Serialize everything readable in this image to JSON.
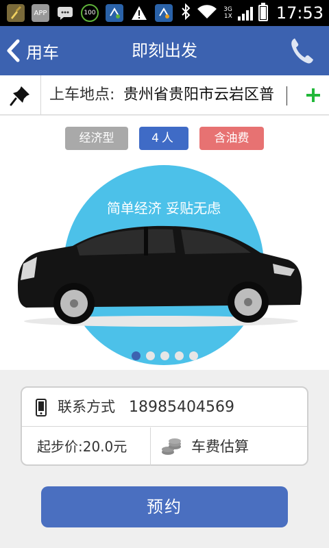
{
  "status_bar": {
    "time": "17:53",
    "net_top": "3G",
    "net_bottom": "1X",
    "app_badge": "APP",
    "percent_badge": "100"
  },
  "title_bar": {
    "back_label": "用车",
    "title": "即刻出发"
  },
  "pickup": {
    "label": "上车地点:",
    "value": "贵州省贵阳市云岩区普"
  },
  "tags": [
    {
      "label": "经济型"
    },
    {
      "label": "4人"
    },
    {
      "label": "含油费"
    }
  ],
  "banner": {
    "slogan": "简单经济  妥贴无虑",
    "slide_count": 5,
    "active_slide": 1
  },
  "contact": {
    "label": "联系方式",
    "value": "18985404569"
  },
  "price": {
    "text": "起步价:20.0元"
  },
  "estimate": {
    "label": "车费估算"
  },
  "reserve_button": {
    "label": "预约"
  },
  "colors": {
    "primary": "#3c62b0",
    "accent_green": "#22b83a",
    "tag_red": "#e77272",
    "circle_blue": "#4cc1e9"
  },
  "icons": [
    "signal-icon",
    "pin-icon",
    "phone-icon",
    "plus-icon",
    "mobile-icon",
    "coins-icon",
    "chevron-left-icon"
  ]
}
